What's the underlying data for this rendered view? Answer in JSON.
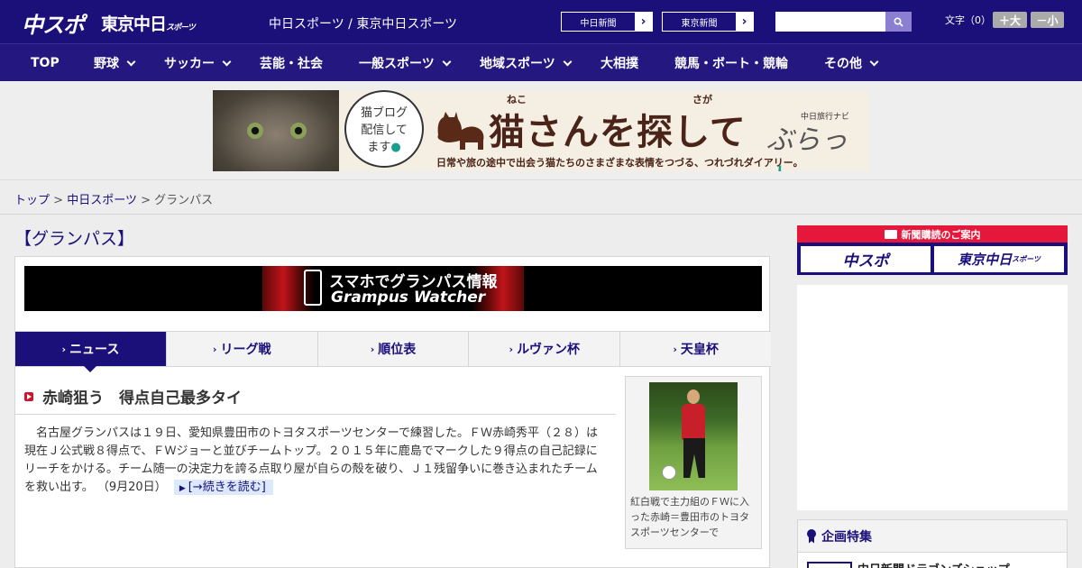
{
  "header": {
    "logo_main": "中スポ",
    "logo_tokyo": "東京中日",
    "logo_tokyo_small": "スポーツ",
    "site_name": "中日スポーツ / 東京中日スポーツ",
    "ext_links": [
      "中日新聞",
      "東京新聞"
    ],
    "font_size_label": "文字（0）",
    "font_bigger": "＋大",
    "font_smaller": "－小"
  },
  "nav": {
    "items": [
      {
        "label": "TOP",
        "has_menu": false
      },
      {
        "label": "野球",
        "has_menu": true
      },
      {
        "label": "サッカー",
        "has_menu": true
      },
      {
        "label": "芸能・社会",
        "has_menu": false
      },
      {
        "label": "一般スポーツ",
        "has_menu": true
      },
      {
        "label": "地域スポーツ",
        "has_menu": true
      },
      {
        "label": "大相撲",
        "has_menu": false
      },
      {
        "label": "競馬・ボート・競輪",
        "has_menu": false
      },
      {
        "label": "その他",
        "has_menu": true
      }
    ]
  },
  "banner": {
    "bubble": [
      "猫ブログ",
      "配信して",
      "ます"
    ],
    "title": "猫さんを探して",
    "ruby_1": "ねこ",
    "ruby_2": "さが",
    "subtitle": "日常や旅の途中で出会う猫たちのさまざまな表情をつづる、つれづれダイアリー。",
    "brand_small": "中日旅行ナビ",
    "brand_big_1": "ぶらっ",
    "brand_big_2": "人"
  },
  "breadcrumb": {
    "items": [
      "トップ",
      "中日スポーツ"
    ],
    "separator": ">",
    "current": "グランパス"
  },
  "page": {
    "heading": "【グランパス】"
  },
  "grampus_banner": {
    "line1": "スマホでグランパス情報",
    "line2": "Grampus Watcher"
  },
  "tabs": [
    {
      "label": "ニュース",
      "active": true
    },
    {
      "label": "リーグ戦",
      "active": false
    },
    {
      "label": "順位表",
      "active": false
    },
    {
      "label": "ルヴァン杯",
      "active": false
    },
    {
      "label": "天皇杯",
      "active": false
    }
  ],
  "article": {
    "title": "赤崎狙う　得点自己最多タイ",
    "body": "名古屋グランパスは１９日、愛知県豊田市のトヨタスポーツセンターで練習した。ＦＷ赤崎秀平（２８）は現在Ｊ公式戦８得点で、ＦＷジョーと並びチームトップ。２０１５年に鹿島でマークした９得点の自己記録にリーチをかける。チーム随一の決定力を誇る点取り屋が自らの殻を破り、Ｊ１残留争いに巻き込まれたチームを救い出す。",
    "date": "（9月20日）",
    "more_link": "[→続きを読む]",
    "photo_caption": "紅白戦で主力組のＦＷに入った赤崎＝豊田市のトヨタスポーツセンターで"
  },
  "sidebar": {
    "subscribe_title": "新聞購読のご案内",
    "subscribe_logos": [
      "中スポ",
      "東京中日"
    ],
    "subscribe_logo_small": "スポーツ",
    "feature_title": "企画特集",
    "feature_item": "中日新聞ドラゴンズショップ"
  },
  "colors": {
    "brand_navy": "#1b0f7a",
    "accent_red": "#e5173a",
    "link_bg": "#dbe9fb"
  }
}
